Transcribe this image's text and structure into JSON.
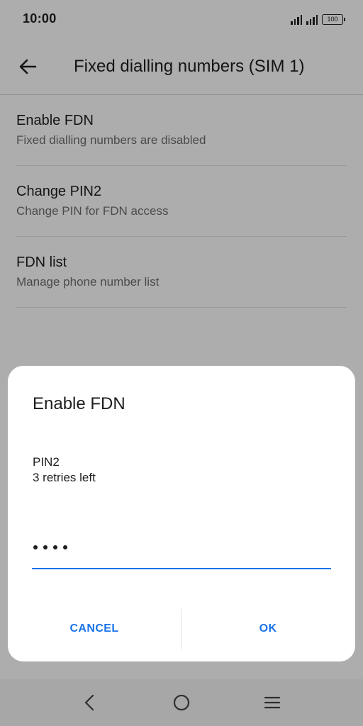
{
  "status_bar": {
    "time": "10:00",
    "battery": "100",
    "icons": [
      "signal-icon",
      "signal-icon",
      "battery-icon"
    ]
  },
  "toolbar": {
    "title": "Fixed dialling numbers (SIM 1)",
    "back_icon": "back-arrow-icon"
  },
  "settings": {
    "items": [
      {
        "title": "Enable FDN",
        "summary": "Fixed dialling numbers are disabled"
      },
      {
        "title": "Change PIN2",
        "summary": "Change PIN for FDN access"
      },
      {
        "title": "FDN list",
        "summary": "Manage phone number list"
      }
    ]
  },
  "dialog": {
    "title": "Enable FDN",
    "message_line1": "PIN2",
    "message_line2": "3 retries left",
    "pin_masked_length": 4,
    "cancel_label": "CANCEL",
    "ok_label": "OK"
  },
  "nav_bar": {
    "icons": [
      "back-icon",
      "home-icon",
      "menu-icon"
    ]
  },
  "colors": {
    "accent": "#1a73e8",
    "scrim": "rgba(0,0,0,0.32)"
  }
}
